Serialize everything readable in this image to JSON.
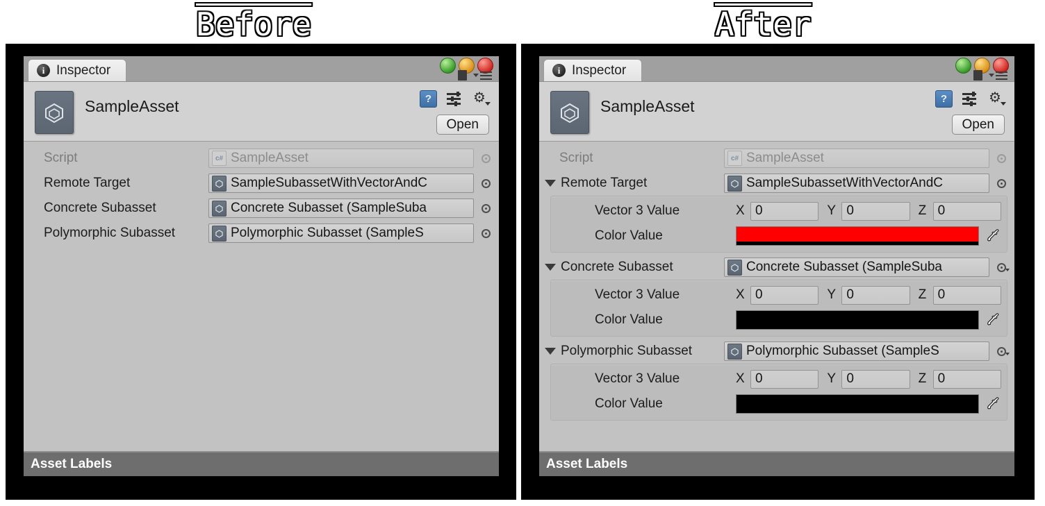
{
  "captions": {
    "before": "Before",
    "after": "After"
  },
  "window": {
    "tab_label": "Inspector",
    "tab_icon": "info-icon",
    "window_buttons": [
      "green-dot",
      "orange-dot",
      "red-dot"
    ],
    "lock_icon": "lock-icon",
    "menu_icon": "hamburger-menu-icon",
    "asset_title": "SampleAsset",
    "asset_icon": "unity-asset-icon",
    "help_icon": "help-book-icon",
    "preset_icon": "preset-sliders-icon",
    "gear_icon": "gear-icon",
    "open_label": "Open",
    "footer_label": "Asset Labels"
  },
  "fields": {
    "script_label": "Script",
    "script_value": "SampleAsset",
    "script_icon": "csharp-script-icon",
    "remote_target_label": "Remote Target",
    "remote_target_value": "SampleSubassetWithVectorAndC",
    "concrete_label": "Concrete Subasset",
    "concrete_value": "Concrete Subasset (SampleSuba",
    "polymorphic_label": "Polymorphic Subasset",
    "polymorphic_value": "Polymorphic Subasset (SampleS",
    "vector3_label": "Vector 3 Value",
    "vector_x_label": "X",
    "vector_y_label": "Y",
    "vector_z_label": "Z",
    "vector_x_value": "0",
    "vector_y_value": "0",
    "vector_z_value": "0",
    "color_label": "Color Value",
    "picker_icon": "object-picker-icon",
    "eyedropper_icon": "eyedropper-icon"
  },
  "colors": {
    "remote_target_color": "#FF0000",
    "concrete_color": "#000000",
    "polymorphic_color": "#000000",
    "alpha_bar": "#000000",
    "panel_bg": "#C2C2C2",
    "header_bg": "#D2D2D2",
    "tabstrip_bg": "#A0A0A0",
    "footer_bg": "#6E6E6E",
    "backdrop": "#000000"
  }
}
